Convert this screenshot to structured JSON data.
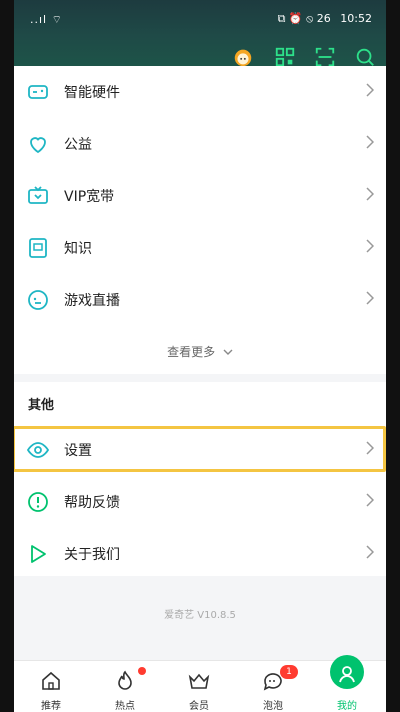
{
  "statusbar": {
    "left": "..ıl ⌔",
    "icons": "⧉ ⏰ ⦸ 26",
    "time": "10:52"
  },
  "list": {
    "items": [
      {
        "label": "智能硬件",
        "icon": "game-controller-icon"
      },
      {
        "label": "公益",
        "icon": "heart-icon"
      },
      {
        "label": "VIP宽带",
        "icon": "tv-icon"
      },
      {
        "label": "知识",
        "icon": "book-icon"
      },
      {
        "label": "游戏直播",
        "icon": "chat-smile-icon"
      }
    ],
    "more": "查看更多"
  },
  "other": {
    "title": "其他",
    "items": [
      {
        "label": "设置",
        "icon": "eye-settings-icon"
      },
      {
        "label": "帮助反馈",
        "icon": "alert-icon"
      },
      {
        "label": "关于我们",
        "icon": "play-icon"
      }
    ]
  },
  "version": "爱奇艺 V10.8.5",
  "tabbar": {
    "tabs": [
      {
        "label": "推荐"
      },
      {
        "label": "热点"
      },
      {
        "label": "会员"
      },
      {
        "label": "泡泡",
        "badge": "1"
      },
      {
        "label": "我的"
      }
    ]
  },
  "colors": {
    "accent": "#00c26e",
    "highlight": "#f4c542",
    "header": "#1f4a47"
  }
}
